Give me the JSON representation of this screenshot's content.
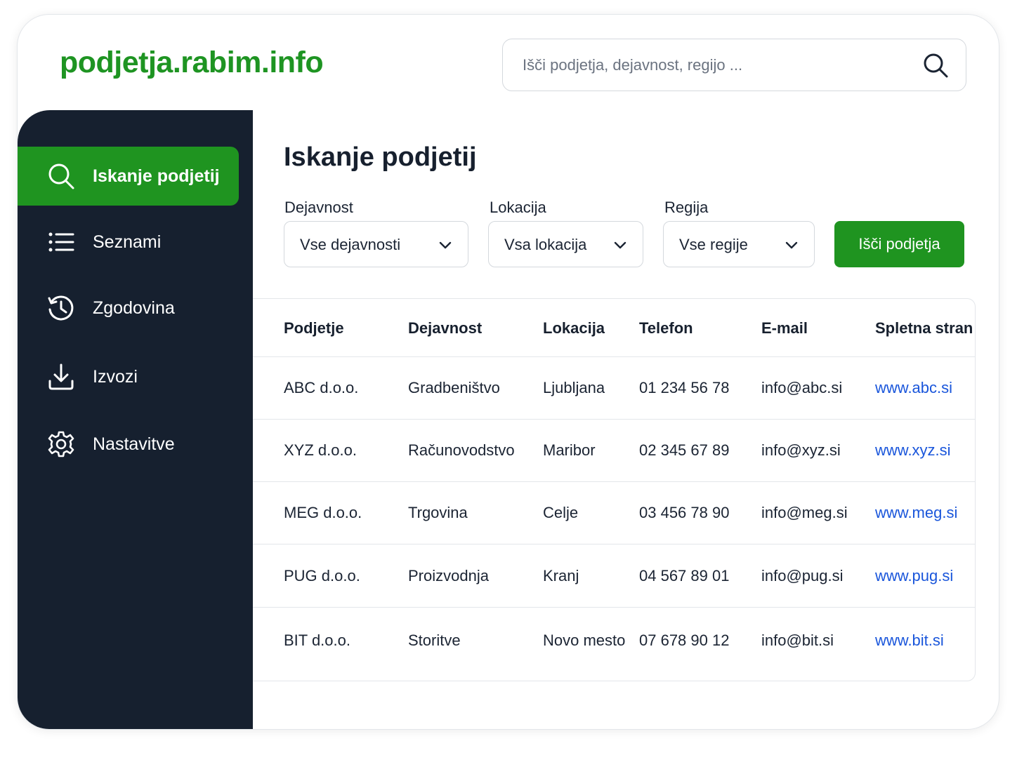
{
  "header": {
    "logo": "podjetja.rabim.info",
    "search_placeholder": "Išči podjetja, dejavnost, regijo ..."
  },
  "sidebar": {
    "items": [
      {
        "label": "Iskanje podjetij",
        "icon": "search-icon",
        "active": true
      },
      {
        "label": "Seznami",
        "icon": "list-icon",
        "active": false
      },
      {
        "label": "Zgodovina",
        "icon": "history-icon",
        "active": false
      },
      {
        "label": "Izvozi",
        "icon": "download-icon",
        "active": false
      },
      {
        "label": "Nastavitve",
        "icon": "gear-icon",
        "active": false
      }
    ]
  },
  "main": {
    "title": "Iskanje podjetij",
    "filters": [
      {
        "label": "Dejavnost",
        "value": "Vse dejavnosti"
      },
      {
        "label": "Lokacija",
        "value": "Vsa lokacija"
      },
      {
        "label": "Regija",
        "value": "Vse regije"
      }
    ],
    "search_button": "Išči podjetja"
  },
  "table": {
    "columns": [
      "Podjetje",
      "Dejavnost",
      "Lokacija",
      "Telefon",
      "E-mail",
      "Spletna stran"
    ],
    "rows": [
      [
        "ABC d.o.o.",
        "Gradbeništvo",
        "Ljubljana",
        "01 234 56 78",
        "info@abc.si",
        "www.abc.si"
      ],
      [
        "XYZ d.o.o.",
        "Računovodstvo",
        "Maribor",
        "02 345 67 89",
        "info@xyz.si",
        "www.xyz.si"
      ],
      [
        "MEG d.o.o.",
        "Trgovina",
        "Celje",
        "03 456 78 90",
        "info@meg.si",
        "www.meg.si"
      ],
      [
        "PUG d.o.o.",
        "Proizvodnja",
        "Kranj",
        "04 567 89 01",
        "info@pug.si",
        "www.pug.si"
      ],
      [
        "BIT d.o.o.",
        "Storitve",
        "Novo mesto",
        "07 678 90 12",
        "info@bit.si",
        "www.bit.si"
      ]
    ]
  },
  "colors": {
    "brand_green": "#1f9420",
    "sidebar_bg": "#16202f",
    "link_blue": "#1a56db"
  }
}
